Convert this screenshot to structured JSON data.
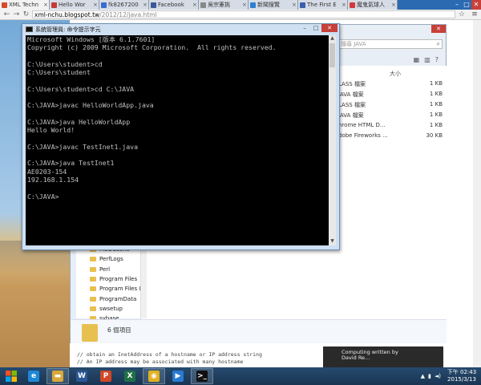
{
  "browser": {
    "tabs": [
      {
        "label": "XML Techn",
        "color": "#d64a2b",
        "active": true
      },
      {
        "label": "Hello Wor",
        "color": "#c43a3a"
      },
      {
        "label": "fk8267200",
        "color": "#3b6bd1"
      },
      {
        "label": "Facebook",
        "color": "#3b5998"
      },
      {
        "label": "吳宗憲挑",
        "color": "#888888"
      },
      {
        "label": "新聞搜覽",
        "color": "#2f7fd1"
      },
      {
        "label": "The First E",
        "color": "#3a5fb0"
      },
      {
        "label": "魔鬼氣球人",
        "color": "#d13a3a"
      }
    ],
    "url_host": "xml-nchu.blogspot.tw",
    "url_path": "/2012/12/java.html",
    "win_controls": [
      "–",
      "□",
      "✕"
    ]
  },
  "explorer": {
    "search_placeholder": "搜尋 JAVA",
    "size_header": "大小",
    "files": [
      {
        "type": "LASS 檔案",
        "size": "1 KB"
      },
      {
        "type": "JAVA 檔案",
        "size": "1 KB"
      },
      {
        "type": "LASS 檔案",
        "size": "1 KB"
      },
      {
        "type": "JAVA 檔案",
        "size": "1 KB"
      },
      {
        "type": "hrome HTML D...",
        "size": "1 KB"
      },
      {
        "type": "dobe Fireworks ...",
        "size": "30 KB"
      }
    ],
    "tree": [
      "MSOCache",
      "PerfLogs",
      "Perl",
      "Program Files",
      "Program Files (",
      "ProgramData",
      "swsetup",
      "sybase"
    ],
    "item_count": "6 個項目"
  },
  "cmd": {
    "title": "系統管理員: 命令提示字元",
    "lines": [
      "Microsoft Windows [版本 6.1.7601]",
      "Copyright (c) 2009 Microsoft Corporation.  All rights reserved.",
      "",
      "C:\\Users\\student>cd",
      "C:\\Users\\student",
      "",
      "C:\\Users\\student>cd C:\\JAVA",
      "",
      "C:\\JAVA>javac HelloWorldApp.java",
      "",
      "C:\\JAVA>java HelloWorldApp",
      "Hello World!",
      "",
      "C:\\JAVA>javac TestInet1.java",
      "",
      "C:\\JAVA>java TestInet1",
      "AE0203-154",
      "192.168.1.154",
      "",
      "C:\\JAVA>"
    ]
  },
  "blog": {
    "code_lines": [
      "// obtain an InetAddress of a hostname or IP address string",
      "// An IP address may be associated with many hostname"
    ],
    "ad_text": "Computing written by David Re..."
  },
  "taskbar": {
    "apps": [
      {
        "name": "ie-icon",
        "glyph": "e",
        "color": "#1e88d6",
        "open": false
      },
      {
        "name": "explorer-icon",
        "glyph": "▬",
        "color": "#d9a93a",
        "open": true
      },
      {
        "name": "word-icon",
        "glyph": "W",
        "color": "#2b5797",
        "open": false
      },
      {
        "name": "powerpoint-icon",
        "glyph": "P",
        "color": "#d24726",
        "open": false
      },
      {
        "name": "excel-icon",
        "glyph": "X",
        "color": "#1e7145",
        "open": false
      },
      {
        "name": "chrome-icon",
        "glyph": "◉",
        "color": "#e0b020",
        "open": true
      },
      {
        "name": "media-icon",
        "glyph": "▶",
        "color": "#2a7ad1",
        "open": false
      },
      {
        "name": "cmd-icon",
        "glyph": ">_",
        "color": "#111111",
        "open": true
      }
    ],
    "time": "下午 02:43",
    "date": "2015/3/13"
  }
}
